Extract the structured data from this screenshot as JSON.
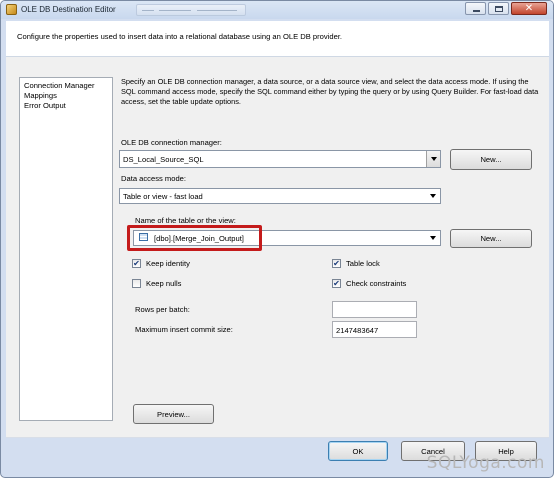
{
  "window": {
    "title": "OLE DB Destination Editor",
    "header_text": "Configure the properties used to insert data into a relational database using an OLE DB provider."
  },
  "nav": {
    "items": [
      "Connection Manager",
      "Mappings",
      "Error Output"
    ]
  },
  "content": {
    "description": "Specify an OLE DB connection manager, a data source, or a data source view, and select the data access mode. If using the SQL command access mode, specify the SQL command either by typing the query or by using Query Builder. For fast-load data access, set the table update options.",
    "connection_manager_label": "OLE DB connection manager:",
    "connection_manager_value": "DS_Local_Source_SQL",
    "new_button_1": "New...",
    "data_access_label": "Data access mode:",
    "data_access_value": "Table or view - fast load",
    "table_label": "Name of the table or the view:",
    "table_value": "[dbo].[Merge_Join_Output]",
    "new_button_2": "New...",
    "keep_identity": "Keep identity",
    "keep_nulls": "Keep nulls",
    "table_lock": "Table lock",
    "check_constraints": "Check constraints",
    "rows_per_batch_label": "Rows per batch:",
    "rows_per_batch_value": "",
    "max_commit_label": "Maximum insert commit size:",
    "max_commit_value": "2147483647",
    "preview_button": "Preview..."
  },
  "checkboxes": {
    "keep_identity": true,
    "keep_nulls": false,
    "table_lock": true,
    "check_constraints": true
  },
  "footer": {
    "ok": "OK",
    "cancel": "Cancel",
    "help": "Help"
  },
  "watermark": "SQLYoga.com",
  "colors": {
    "highlight": "#c41b1b"
  }
}
